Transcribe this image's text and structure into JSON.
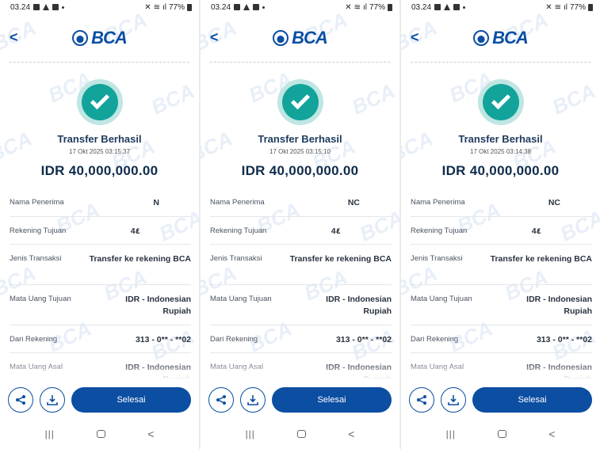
{
  "screens": [
    {
      "status": {
        "time": "03.24",
        "battery": "77%"
      },
      "header": {
        "back_icon": "chevron-left-icon",
        "logo_text": "BCA"
      },
      "receipt": {
        "title": "Transfer Berhasil",
        "timestamp": "17 Okt 2025 03:15:37",
        "amount": "IDR 40,000,000.00",
        "rows": [
          {
            "label": "Nama Penerima",
            "value": "N"
          },
          {
            "label": "Rekening Tujuan",
            "value": "4٤"
          },
          {
            "label": "Jenis Transaksi",
            "value": "Transfer ke rekening BCA"
          },
          {
            "label": "Mata Uang Tujuan",
            "value": "IDR - Indonesian Rupiah"
          },
          {
            "label": "Dari Rekening",
            "value": "313 - 0** - **02"
          },
          {
            "label": "Mata Uang Asal",
            "value": "IDR - Indonesian Rupiah"
          }
        ]
      },
      "actions": {
        "share_icon": "share-icon",
        "download_icon": "download-icon",
        "done_label": "Selesai"
      }
    },
    {
      "status": {
        "time": "03.24",
        "battery": "77%"
      },
      "header": {
        "back_icon": "chevron-left-icon",
        "logo_text": "BCA"
      },
      "receipt": {
        "title": "Transfer Berhasil",
        "timestamp": "17 Okt 2025 03:15:10",
        "amount": "IDR 40,000,000.00",
        "rows": [
          {
            "label": "Nama Penerima",
            "value": "NC"
          },
          {
            "label": "Rekening Tujuan",
            "value": "4٤"
          },
          {
            "label": "Jenis Transaksi",
            "value": "Transfer ke rekening BCA"
          },
          {
            "label": "Mata Uang Tujuan",
            "value": "IDR - Indonesian Rupiah"
          },
          {
            "label": "Dari Rekening",
            "value": "313 - 0** - **02"
          },
          {
            "label": "Mata Uang Asal",
            "value": "IDR - Indonesian Rupiah"
          }
        ]
      },
      "actions": {
        "share_icon": "share-icon",
        "download_icon": "download-icon",
        "done_label": "Selesai"
      }
    },
    {
      "status": {
        "time": "03.24",
        "battery": "77%"
      },
      "header": {
        "back_icon": "chevron-left-icon",
        "logo_text": "BCA"
      },
      "receipt": {
        "title": "Transfer Berhasil",
        "timestamp": "17 Okt 2025 03:14:38",
        "amount": "IDR 40,000,000.00",
        "rows": [
          {
            "label": "Nama Penerima",
            "value": "NC"
          },
          {
            "label": "Rekening Tujuan",
            "value": "4٤"
          },
          {
            "label": "Jenis Transaksi",
            "value": "Transfer ke rekening BCA"
          },
          {
            "label": "Mata Uang Tujuan",
            "value": "IDR - Indonesian Rupiah"
          },
          {
            "label": "Dari Rekening",
            "value": "313 - 0** - **02"
          },
          {
            "label": "Mata Uang Asal",
            "value": "IDR - Indonesian Rupiah"
          }
        ]
      },
      "actions": {
        "share_icon": "share-icon",
        "download_icon": "download-icon",
        "done_label": "Selesai"
      }
    }
  ],
  "colors": {
    "brand": "#0b4ea2",
    "success": "#12a39b",
    "success_ring": "#bfe6e2"
  }
}
